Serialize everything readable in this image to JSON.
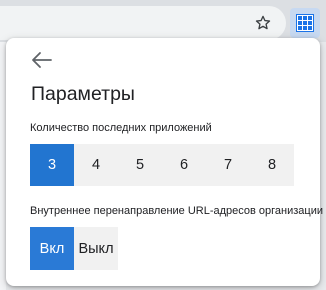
{
  "browser": {
    "star_icon": "star-outline-icon",
    "extension_icon": "grid-icon",
    "extension_color": "#1a73e8"
  },
  "popup": {
    "back_icon": "arrow-left-icon",
    "title": "Параметры",
    "recent_apps": {
      "label": "Количество последних приложений",
      "options": [
        "3",
        "4",
        "5",
        "6",
        "7",
        "8"
      ],
      "selected": "3"
    },
    "url_redirect": {
      "label": "Внутреннее перенаправление URL-адресов организации",
      "options": [
        "Вкл",
        "Выкл"
      ],
      "selected": "Вкл"
    },
    "accent_color": "#2275d0"
  }
}
